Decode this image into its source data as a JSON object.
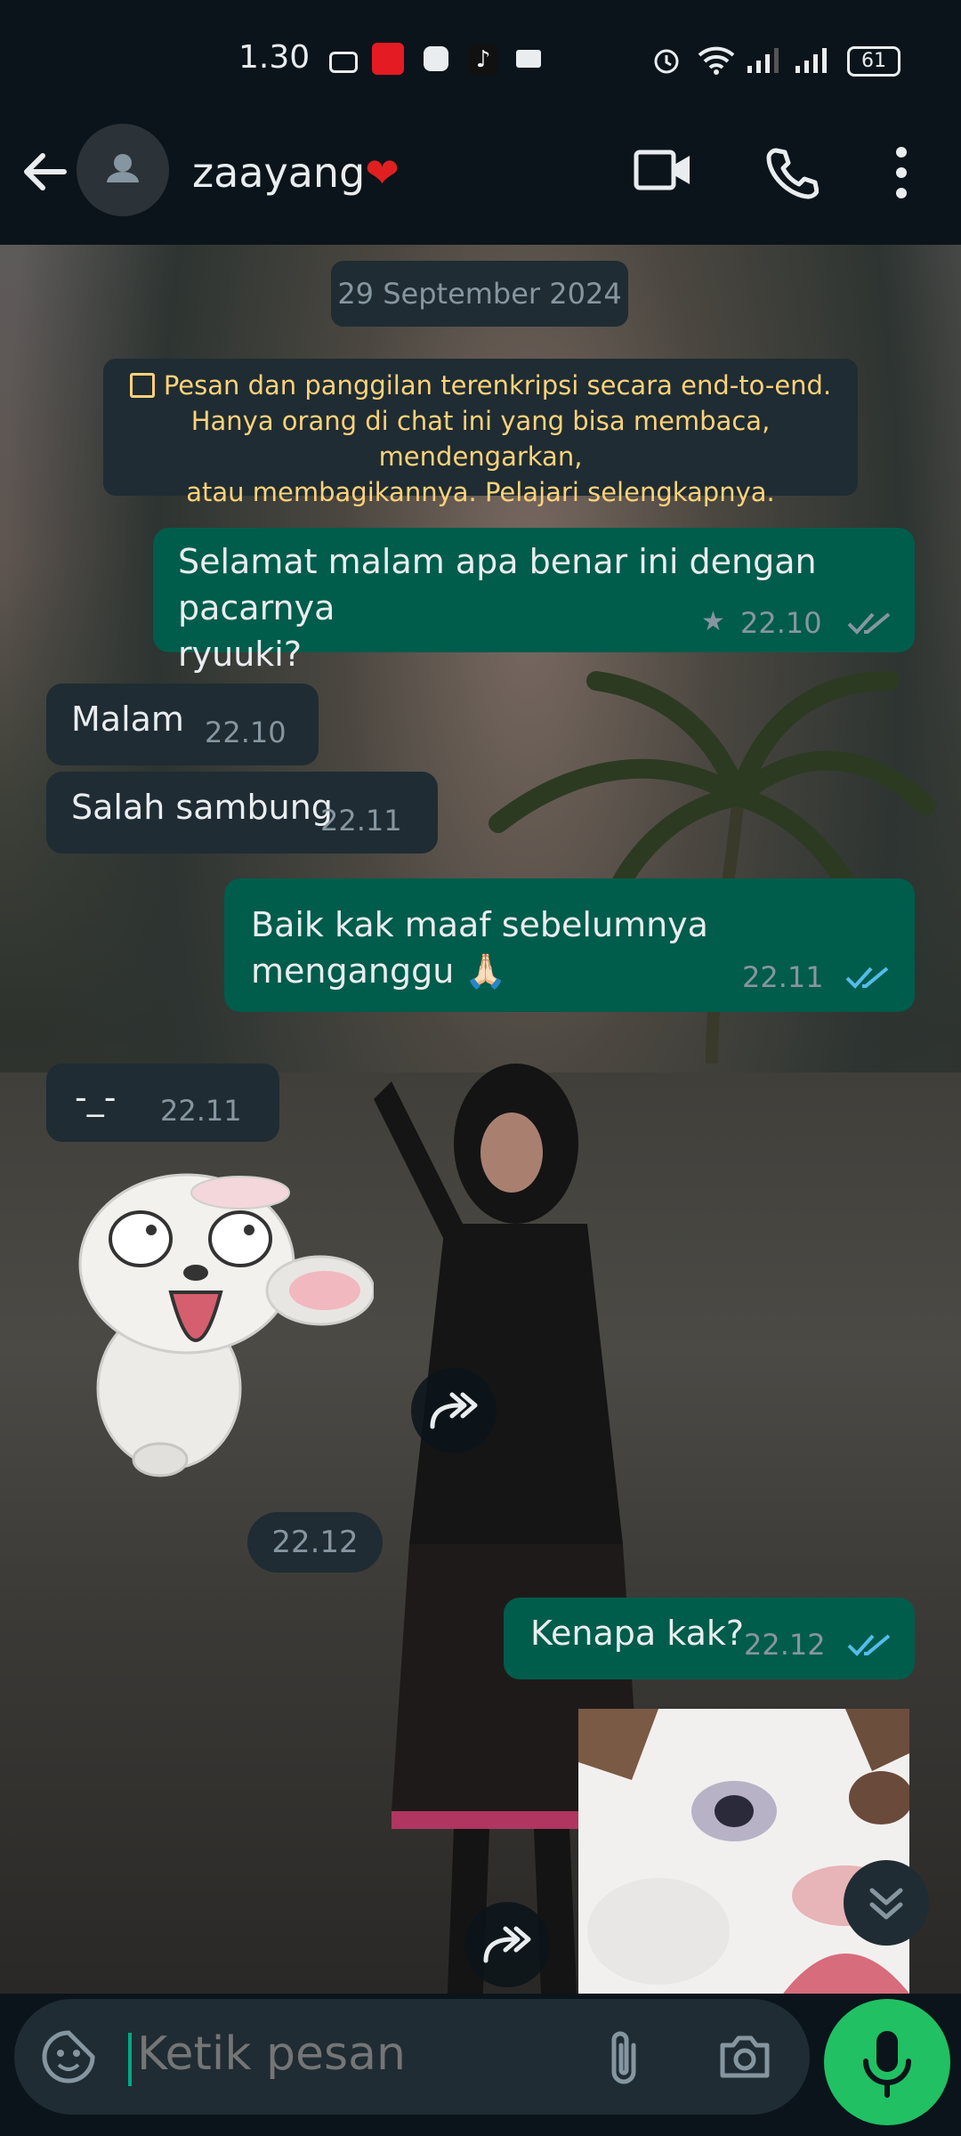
{
  "status_bar": {
    "time": "1.30",
    "battery": "61"
  },
  "header": {
    "contact_name": "zaayang",
    "heart": "❤"
  },
  "chat": {
    "date_label": "29 September 2024",
    "encryption_notice_lines": [
      "Pesan dan panggilan terenkripsi secara end-to-end.",
      "Hanya orang di chat ini yang bisa membaca, mendengarkan,",
      "atau membagikannya. Pelajari selengkapnya."
    ],
    "messages": [
      {
        "direction": "out",
        "lines": [
          "Selamat malam apa benar ini dengan pacarnya",
          "ryuuki?"
        ],
        "time": "22.10",
        "starred": true,
        "status": "delivered"
      },
      {
        "direction": "in",
        "lines": [
          "Malam"
        ],
        "time": "22.10"
      },
      {
        "direction": "in",
        "lines": [
          "Salah sambung"
        ],
        "time": "22.11"
      },
      {
        "direction": "out",
        "lines": [
          "Baik kak maaf sebelumnya menganggu 🙏🏻"
        ],
        "time": "22.11",
        "status": "read"
      },
      {
        "direction": "in",
        "lines": [
          "-_-"
        ],
        "time": "22.11"
      },
      {
        "direction": "in",
        "type": "sticker",
        "time": "22.12"
      },
      {
        "direction": "out",
        "lines": [
          "Kenapa kak?"
        ],
        "time": "22.12",
        "status": "read"
      },
      {
        "direction": "in",
        "type": "image"
      }
    ]
  },
  "composer": {
    "placeholder": "Ketik pesan"
  },
  "icons": {
    "back": "arrow-left-icon",
    "video": "video-call-icon",
    "call": "phone-icon",
    "more": "more-vert-icon",
    "emoji": "sticker-icon",
    "attach": "paperclip-icon",
    "camera": "camera-icon",
    "mic": "mic-icon",
    "forward": "forward-icon",
    "scroll": "chevrons-down-icon"
  },
  "colors": {
    "outgoing_bubble": "#005c4b",
    "incoming_bubble": "#1f2c33",
    "read_ticks": "#53bdeb",
    "accent": "#21c063",
    "notice_text": "#ffd279"
  }
}
